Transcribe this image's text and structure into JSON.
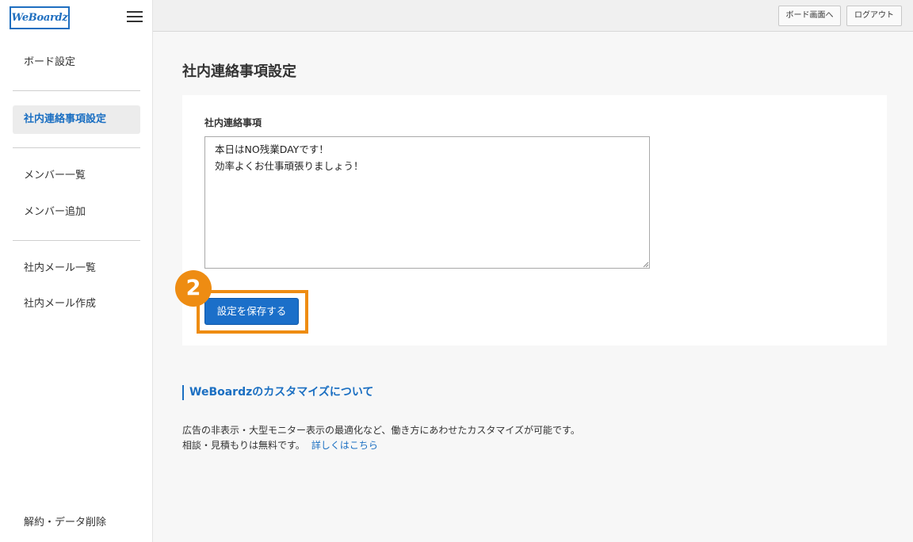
{
  "logo": {
    "text": "WeBoardz"
  },
  "sidebar": {
    "items": [
      {
        "label": "ボード設定"
      },
      {
        "label": "社内連絡事項設定",
        "active": true
      },
      {
        "label": "メンバー一覧"
      },
      {
        "label": "メンバー追加"
      },
      {
        "label": "社内メール一覧"
      },
      {
        "label": "社内メール作成"
      }
    ],
    "footer_item": "解約・データ削除"
  },
  "topbar": {
    "board_view_label": "ボード画面へ",
    "logout_label": "ログアウト"
  },
  "main": {
    "page_title": "社内連絡事項設定",
    "field_label": "社内連絡事項",
    "message_value": "本日はNO残業DAYです！\n効率よくお仕事頑張りましょう！",
    "save_label": "設定を保存する",
    "step_badge": "2"
  },
  "customize": {
    "heading": "WeBoardzのカスタマイズについて",
    "line1": "広告の非表示・大型モニター表示の最適化など、働き方にあわせたカスタマイズが可能です。",
    "line2": "相談・見積もりは無料です。",
    "link": "詳しくはこちら"
  },
  "colors": {
    "accent_blue": "#1b6fc9",
    "highlight_orange": "#ee8c12"
  }
}
